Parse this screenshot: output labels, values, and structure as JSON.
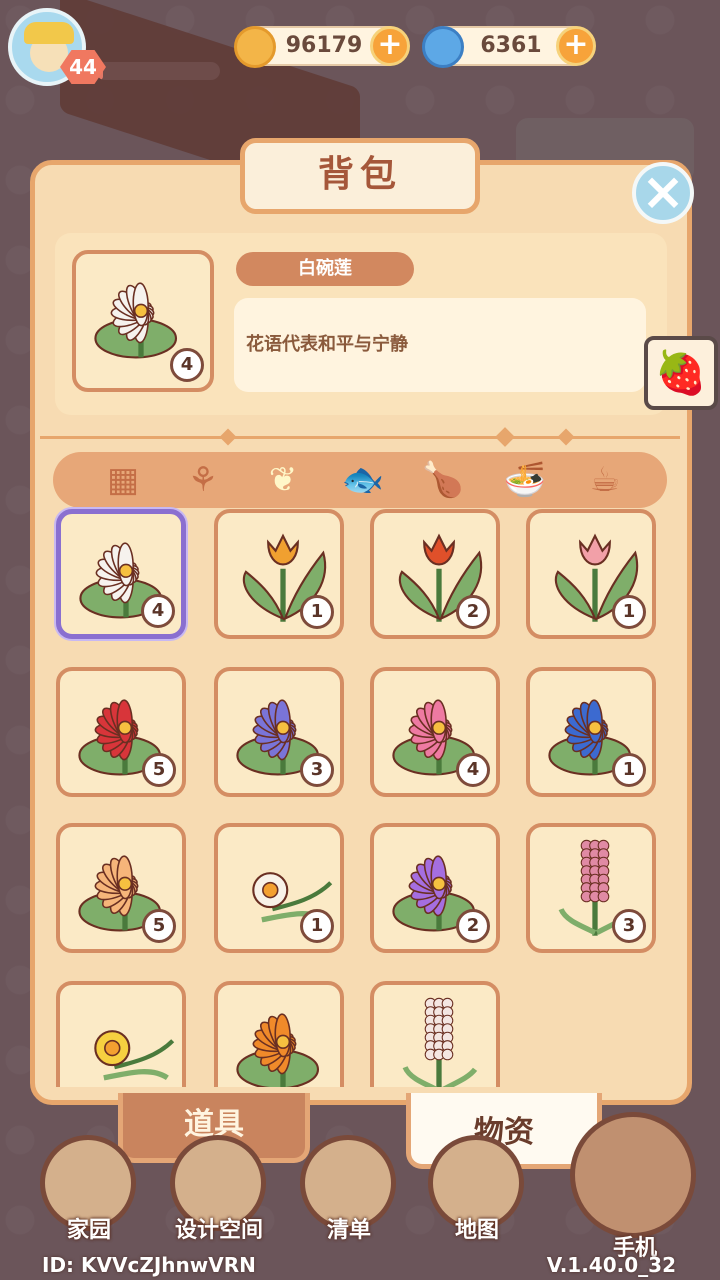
{
  "player": {
    "level": "44",
    "xp_progress": 0.06
  },
  "currency": {
    "coins": {
      "value": "96179",
      "icon": "coin-icon",
      "color": "#f3b548"
    },
    "gems": {
      "value": "6361",
      "icon": "swirl-gem-icon",
      "color": "#5da8e6"
    }
  },
  "panel": {
    "title": "背包",
    "close_icon": "close-icon"
  },
  "selected_item": {
    "name": "白碗莲",
    "description": "花语代表和平与宁静",
    "count": "4"
  },
  "category_tabs": [
    {
      "icon": "grid-icon",
      "glyph": "▦",
      "active": false
    },
    {
      "icon": "seed-bag-icon",
      "glyph": "⚘",
      "active": false
    },
    {
      "icon": "sprout-icon",
      "glyph": "❦",
      "active": true
    },
    {
      "icon": "fish-icon",
      "glyph": "🐟",
      "active": false
    },
    {
      "icon": "drumstick-icon",
      "glyph": "🍗",
      "active": false
    },
    {
      "icon": "bowl-icon",
      "glyph": "🍜",
      "active": false
    },
    {
      "icon": "cup-icon",
      "glyph": "☕",
      "active": false
    }
  ],
  "items": [
    {
      "name": "white-waterlily",
      "count": "4",
      "type": "lotus",
      "color": "#f6f2ee",
      "selected": true
    },
    {
      "name": "orange-tulip",
      "count": "1",
      "type": "tulip",
      "color": "#f0a030"
    },
    {
      "name": "red-tulip",
      "count": "2",
      "type": "tulip",
      "color": "#e0502a"
    },
    {
      "name": "pink-tulip",
      "count": "1",
      "type": "tulip",
      "color": "#f2a0a8"
    },
    {
      "name": "red-waterlily",
      "count": "5",
      "type": "lotus",
      "color": "#d8353a"
    },
    {
      "name": "purple-waterlily",
      "count": "3",
      "type": "lotus",
      "color": "#7a74d8"
    },
    {
      "name": "pink-waterlily",
      "count": "4",
      "type": "lotus",
      "color": "#ee7aa2"
    },
    {
      "name": "blue-waterlily",
      "count": "1",
      "type": "lotus",
      "color": "#3c6ad0"
    },
    {
      "name": "peach-waterlily",
      "count": "5",
      "type": "lotus",
      "color": "#f6b57a"
    },
    {
      "name": "white-narcissus",
      "count": "1",
      "type": "narcissus",
      "color": "#f8f2e8"
    },
    {
      "name": "violet-waterlily",
      "count": "2",
      "type": "lotus",
      "color": "#a56ee0"
    },
    {
      "name": "pink-hyacinth",
      "count": "3",
      "type": "hyacinth",
      "color": "#e08aa4"
    },
    {
      "name": "yellow-daffodil",
      "count": "",
      "type": "narcissus",
      "color": "#f6d040"
    },
    {
      "name": "orange-waterlily",
      "count": "",
      "type": "lotus",
      "color": "#f08a2a"
    },
    {
      "name": "white-hyacinth",
      "count": "",
      "type": "hyacinth",
      "color": "#f4e6e2"
    }
  ],
  "bottom_tabs": {
    "tools": "道具",
    "materials": "物资"
  },
  "nav": [
    {
      "label": "家园",
      "icon": "house-icon"
    },
    {
      "label": "设计空间",
      "icon": "ruler-icon"
    },
    {
      "label": "清单",
      "icon": "scroll-icon"
    },
    {
      "label": "地图",
      "icon": "map-pin-icon"
    },
    {
      "label": "手机",
      "icon": "phone-icon"
    }
  ],
  "footer": {
    "id": "ID: KVVcZJhnwVRN",
    "version": "V.1.40.0_32"
  }
}
